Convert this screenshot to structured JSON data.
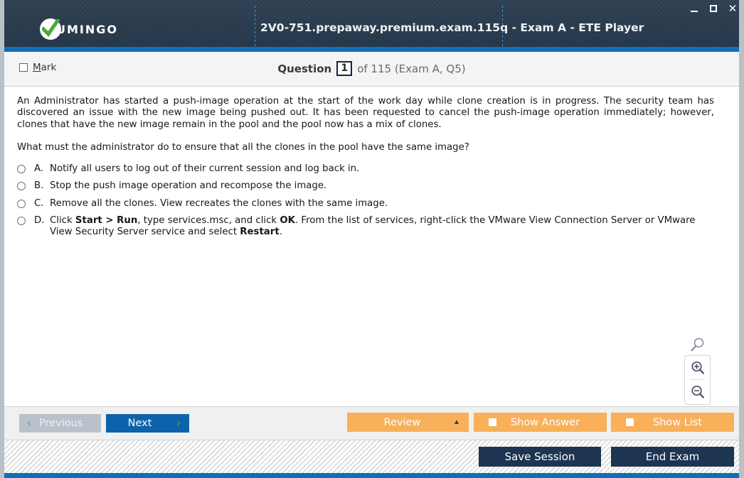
{
  "window": {
    "brand_text": "UMINGO",
    "brand_icon": "check-circle-logo",
    "title": "2V0-751.prepaway.premium.exam.115q - Exam A - ETE Player",
    "controls": {
      "minimize": "minimize-icon",
      "maximize": "maximize-icon",
      "close": "✕"
    },
    "accent_blue": "#0d6fb8",
    "titlebar_bg": "#2a3b4d"
  },
  "question_bar": {
    "mark_label_pre": "",
    "mark_label_accel": "M",
    "mark_label_post": "ark",
    "mark_checked": false,
    "question_word": "Question",
    "question_number": "1",
    "range_text": "of 115 (Exam A, Q5)"
  },
  "content": {
    "stem": "An Administrator has started a push-image operation at the start of the work day while clone creation is in progress. The security team has discovered an issue with the new image being pushed out. It has been requested to cancel the push-image operation immediately; however, clones that have the new image remain in the pool and the pool now has a mix of clones.",
    "prompt": "What must the administrator do to ensure that all the clones in the pool have the same image?",
    "answers": [
      {
        "letter": "A.",
        "text": "Notify all users to log out of their current session and log back in.",
        "html": "Notify all users to log out of their current session and log back in.",
        "selected": false
      },
      {
        "letter": "B.",
        "text": "Stop the push image operation and recompose the image.",
        "html": "Stop the push image operation and recompose the image.",
        "selected": false
      },
      {
        "letter": "C.",
        "text": "Remove all the clones. View recreates the clones with the same image.",
        "html": "Remove all the clones. View recreates the clones with the same image.",
        "selected": false
      },
      {
        "letter": "D.",
        "text": "Click Start > Run, type services.msc, and click OK. From the list of services, right-click the VMware View Connection Server or VMware View Security Server service and select Restart.",
        "html": "Click <b>Start &gt; Run</b>, type services.msc, and click <b>OK</b>. From the list of services, right-click the VMware View Connection Server or VMware View Security Server service and select <b>Restart</b>.",
        "selected": false
      }
    ],
    "zoom_widget": {
      "magnifier_icon": "magnifier-icon",
      "zoom_in_icon": "zoom-in-icon",
      "zoom_out_icon": "zoom-out-icon"
    }
  },
  "nav_bar": {
    "previous_label": "Previous",
    "previous_enabled": false,
    "previous_icon": "chevron-left-icon",
    "next_label": "Next",
    "next_enabled": true,
    "next_icon": "chevron-right-icon",
    "review_label": "Review",
    "review_icon": "caret-up-icon",
    "show_answer_label": "Show Answer",
    "show_list_label": "Show List",
    "orange_color": "#f8b05a",
    "next_color": "#0d63ab",
    "previous_color": "#b9c2cb"
  },
  "footer": {
    "save_session_label": "Save Session",
    "end_exam_label": "End Exam",
    "button_color": "#1d3552"
  }
}
